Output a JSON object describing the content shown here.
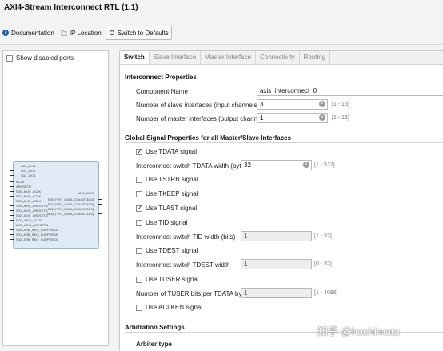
{
  "window": {
    "title": "AXI4-Stream Interconnect RTL (1.1)"
  },
  "toolbar": {
    "documentation": "Documentation",
    "ip_location": "IP Location",
    "switch_defaults": "Switch to Defaults"
  },
  "left_panel": {
    "show_disabled": "Show disabled ports",
    "ports_left": [
      "S00_AXIS",
      "S01_AXIS",
      "S02_AXIS",
      "ACLK",
      "ARESETN",
      "S00_AXIS_ACLK",
      "S01_AXIS_ACLK",
      "S02_AXIS_ACLK",
      "S00_AXIS_ARESETN",
      "S01_AXIS_ARESETN",
      "S02_AXIS_ARESETN",
      "M00_AXIS_ACLK",
      "M00_AXIS_ARESETN",
      "S00_ARB_REQ_SUPPRESS",
      "S01_ARB_REQ_SUPPRESS",
      "S02_ARB_REQ_SUPPRESS"
    ],
    "ports_right": [
      "M00_AXIS",
      "S00_FIFO_DATA_COUNT[31:0]",
      "S01_FIFO_DATA_COUNT[31:0]",
      "S02_FIFO_DATA_COUNT[31:0]",
      "M00_FIFO_DATA_COUNT[31:0]"
    ]
  },
  "tabs": [
    "Switch",
    "Slave Interface",
    "Master Interface",
    "Connectivity",
    "Routing"
  ],
  "interconnect_props": {
    "heading": "Interconnect Properties",
    "component_name_label": "Component Name",
    "component_name": "axis_interconnect_0",
    "slave_label": "Number of slave interfaces (input channels)",
    "slave_value": "3",
    "slave_range": "[1 - 16]",
    "master_label": "Number of master interfaces (output channels)",
    "master_value": "1",
    "master_range": "[1 - 16]"
  },
  "global_props": {
    "heading": "Global Signal Properties for all Master/Slave Interfaces",
    "tdata": "Use TDATA signal",
    "tdata_width_label": "Interconnect switch TDATA width (bytes)",
    "tdata_width": "32",
    "tdata_range": "[1 - 512]",
    "tstrb": "Use TSTRB signal",
    "tkeep": "Use TKEEP signal",
    "tlast": "Use TLAST signal",
    "tid": "Use TID signal",
    "tid_width_label": "Interconnect switch TID width (bits)",
    "tid_width": "1",
    "tid_range": "[1 - 32]",
    "tdest": "Use TDEST signal",
    "tdest_width_label": "Interconnect switch TDEST width",
    "tdest_width": "1",
    "tdest_range": "[0 - 32]",
    "tuser": "Use TUSER signal",
    "tuser_bits_label": "Number of TUSER bits per TDATA byte",
    "tuser_bits": "1",
    "tuser_range": "[1 - 4096]",
    "aclken": "Use ACLKEN signal"
  },
  "arbitration": {
    "heading": "Arbitration Settings",
    "arbiter_type": "Arbiter type"
  },
  "watermark": "知乎 @hachimata"
}
